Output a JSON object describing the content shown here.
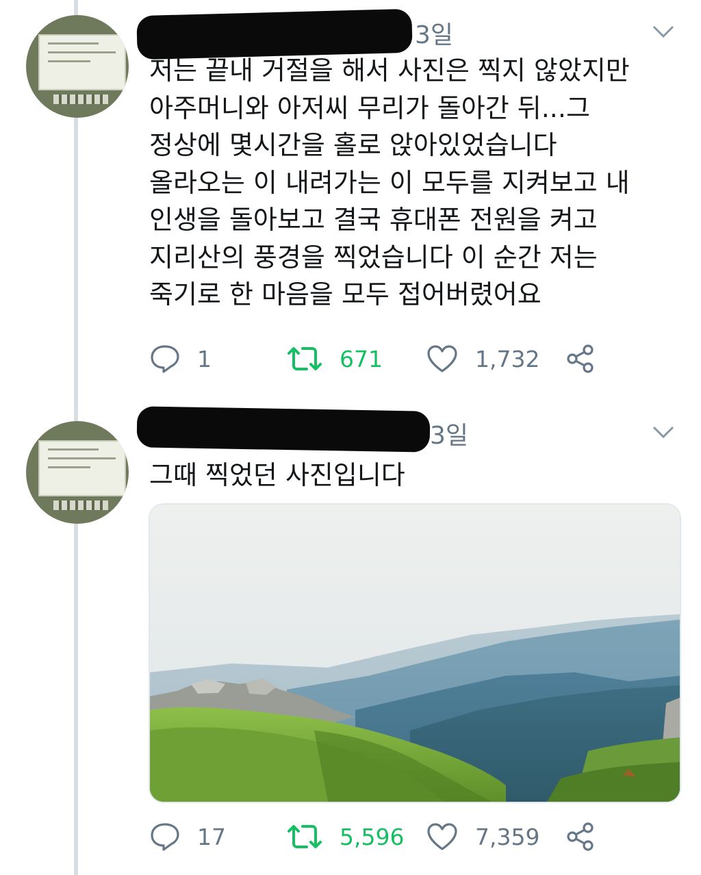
{
  "tweets": [
    {
      "time": "3일",
      "text": "저는 끝내 거절을 해서 사진은 찍지 않았지만\n아주머니와 아저씨 무리가 돌아간 뒤...그\n정상에 몇시간을 홀로 앉아있었습니다\n올라오는 이 내려가는 이 모두를 지켜보고 내\n인생을 돌아보고 결국 휴대폰 전원을 켜고\n지리산의 풍경을 찍었습니다 이 순간 저는\n죽기로 한 마음을 모두 접어버렸어요",
      "replies": "1",
      "retweets": "671",
      "likes": "1,732"
    },
    {
      "time": "3일",
      "text": "그때 찍었던 사진입니다",
      "replies": "17",
      "retweets": "5,596",
      "likes": "7,359"
    }
  ],
  "colors": {
    "retweet": "#17bf63",
    "muted": "#657786",
    "thread_line": "#d9dee3"
  },
  "icons": [
    "reply-icon",
    "retweet-icon",
    "like-icon",
    "share-icon",
    "chevron-down-icon"
  ]
}
